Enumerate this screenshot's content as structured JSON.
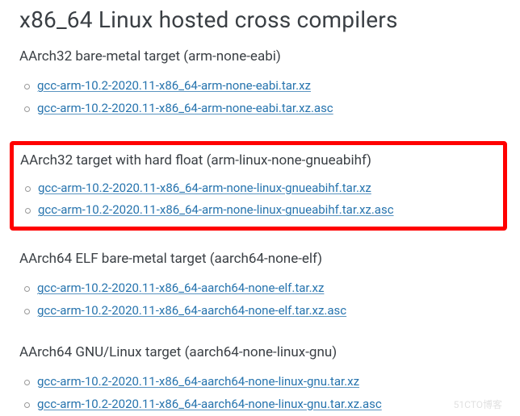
{
  "title": "x86_64 Linux hosted cross compilers",
  "sections": [
    {
      "heading": "AArch32 bare-metal target (arm-none-eabi)",
      "highlighted": false,
      "links": [
        "gcc-arm-10.2-2020.11-x86_64-arm-none-eabi.tar.xz",
        "gcc-arm-10.2-2020.11-x86_64-arm-none-eabi.tar.xz.asc"
      ]
    },
    {
      "heading": "AArch32 target with hard float (arm-linux-none-gnueabihf)",
      "highlighted": true,
      "links": [
        "gcc-arm-10.2-2020.11-x86_64-arm-none-linux-gnueabihf.tar.xz",
        "gcc-arm-10.2-2020.11-x86_64-arm-none-linux-gnueabihf.tar.xz.asc"
      ]
    },
    {
      "heading": "AArch64 ELF bare-metal target (aarch64-none-elf)",
      "highlighted": false,
      "links": [
        "gcc-arm-10.2-2020.11-x86_64-aarch64-none-elf.tar.xz",
        "gcc-arm-10.2-2020.11-x86_64-aarch64-none-elf.tar.xz.asc"
      ]
    },
    {
      "heading": "AArch64 GNU/Linux target (aarch64-none-linux-gnu)",
      "highlighted": false,
      "links": [
        "gcc-arm-10.2-2020.11-x86_64-aarch64-none-linux-gnu.tar.xz",
        "gcc-arm-10.2-2020.11-x86_64-aarch64-none-linux-gnu.tar.xz.asc"
      ]
    }
  ],
  "watermark": "51CTO博客"
}
